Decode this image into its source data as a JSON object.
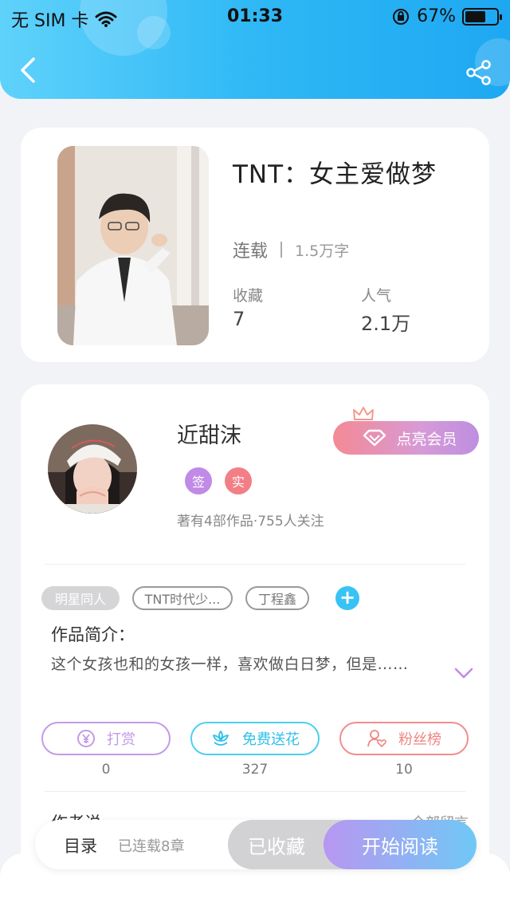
{
  "status_bar": {
    "carrier": "无 SIM 卡",
    "time": "01:33",
    "battery": "67%",
    "battery_level": 0.67
  },
  "book": {
    "title": "TNT：女主爱做梦",
    "status": "连载",
    "word_count": "1.5万字",
    "favorites_label": "收藏",
    "favorites_value": "7",
    "popularity_label": "人气",
    "popularity_value": "2.1万"
  },
  "author": {
    "name": "近甜沫",
    "badges": [
      "签",
      "实"
    ],
    "stats": "著有4部作品·755人关注",
    "vip_button": "点亮会员"
  },
  "tags": [
    "明星同人",
    "TNT时代少...",
    "丁程鑫"
  ],
  "intro": {
    "label": "作品简介：",
    "text": "这个女孩也和的女孩一样，喜欢做白日梦，但是……"
  },
  "actions": [
    {
      "label": "打赏",
      "count": "0"
    },
    {
      "label": "免费送花",
      "count": "327"
    },
    {
      "label": "粉丝榜",
      "count": "10"
    }
  ],
  "author_says": {
    "label": "作者说",
    "right_text": "全部留言"
  },
  "bottom_bar": {
    "toc": "目录",
    "chapters": "已连载8章",
    "collected": "已收藏",
    "read": "开始阅读"
  },
  "colors": {
    "header": "#2fb8f5",
    "badge_sign": "#c08ae6",
    "badge_real": "#f27f86",
    "reward": "#c59ae6",
    "flower": "#4dcfef",
    "fans": "#f08f8c"
  }
}
